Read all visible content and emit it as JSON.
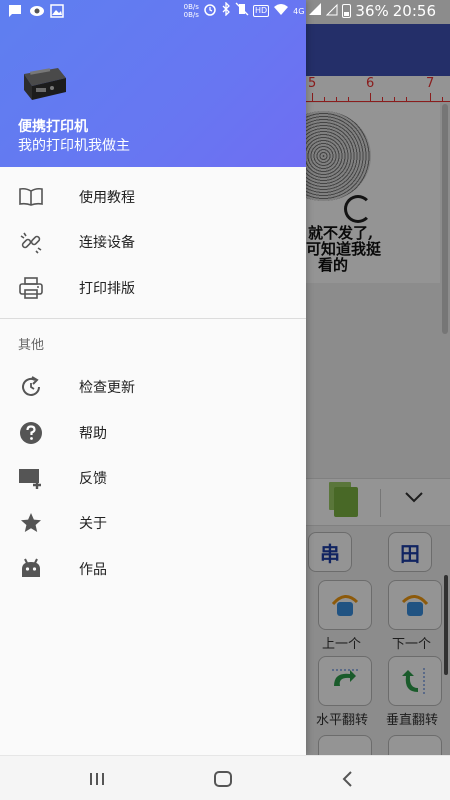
{
  "status_bar": {
    "speed_top": "0B/s",
    "speed_bottom": "0B/s",
    "network": "4G",
    "battery_percent": "36%",
    "time": "20:56",
    "hd": "HD"
  },
  "background": {
    "ruler_labels": [
      "5",
      "6",
      "7"
    ],
    "canvas_text_line1": "就不发了,",
    "canvas_text_line2": "可知道我挺",
    "canvas_text_line3": "看的",
    "buttons": [
      {
        "label": "上一个"
      },
      {
        "label": "下一个"
      },
      {
        "label": "水平翻转"
      },
      {
        "label": "垂直翻转"
      }
    ],
    "top_btn_left": "串",
    "top_btn_right": "田"
  },
  "drawer": {
    "header": {
      "title": "便携打印机",
      "subtitle": "我的打印机我做主"
    },
    "primary_items": [
      {
        "label": "使用教程",
        "icon": "book-icon"
      },
      {
        "label": "连接设备",
        "icon": "link-icon"
      },
      {
        "label": "打印排版",
        "icon": "printer-icon"
      }
    ],
    "section_title": "其他",
    "secondary_items": [
      {
        "label": "检查更新",
        "icon": "update-icon"
      },
      {
        "label": "帮助",
        "icon": "help-icon"
      },
      {
        "label": "反馈",
        "icon": "feedback-icon"
      },
      {
        "label": "关于",
        "icon": "star-icon"
      },
      {
        "label": "作品",
        "icon": "android-icon"
      }
    ]
  },
  "colors": {
    "header_gradient_start": "#5e7ff0",
    "header_gradient_end": "#6f6ef2",
    "icon_gray": "#555555"
  }
}
